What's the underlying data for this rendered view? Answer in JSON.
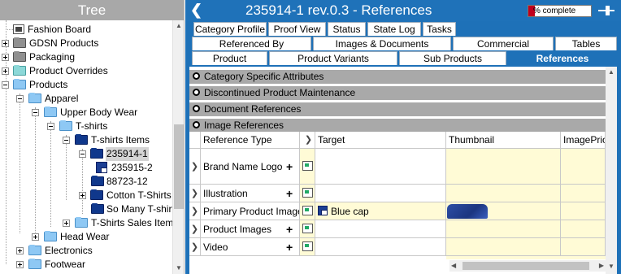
{
  "tree": {
    "title": "Tree",
    "items": [
      {
        "label": "Fashion Board"
      },
      {
        "label": "GDSN Products"
      },
      {
        "label": "Packaging"
      },
      {
        "label": "Product Overrides"
      },
      {
        "label": "Products"
      },
      {
        "label": "Apparel"
      },
      {
        "label": "Upper Body Wear"
      },
      {
        "label": "T-shirts"
      },
      {
        "label": "T-shirts Items"
      },
      {
        "label": "235914-1"
      },
      {
        "label": "235915-2"
      },
      {
        "label": "88723-12"
      },
      {
        "label": "Cotton T-Shirts"
      },
      {
        "label": "So Many T-shirts"
      },
      {
        "label": "T-Shirts Sales Items"
      },
      {
        "label": "Head Wear"
      },
      {
        "label": "Electronics"
      },
      {
        "label": "Footwear"
      }
    ]
  },
  "header": {
    "title": "235914-1 rev.0.3 - References",
    "progress_label": "% complete",
    "progress_fraction": 0.1,
    "back_icon": "back-chevron-icon",
    "pin_icon": "pin-icon"
  },
  "tabs": {
    "row1": [
      "Category Profile",
      "Proof View",
      "Status",
      "State Log",
      "Tasks"
    ],
    "row2": [
      "Referenced By",
      "Images & Documents",
      "Commercial",
      "Tables"
    ],
    "row3": [
      "Product",
      "Product Variants",
      "Sub Products",
      "References"
    ],
    "active": "References"
  },
  "sections": [
    "Category Specific Attributes",
    "Discontinued Product Maintenance",
    "Document References",
    "Image References"
  ],
  "table": {
    "columns": [
      "Reference Type",
      "Target",
      "Thumbnail",
      "ImagePriori"
    ],
    "rows": [
      {
        "type": "Brand Name Logo",
        "target": "",
        "has_thumbnail": false
      },
      {
        "type": "Illustration",
        "target": "",
        "has_thumbnail": false
      },
      {
        "type": "Primary Product Image",
        "target": "Blue cap",
        "has_thumbnail": true
      },
      {
        "type": "Product Images",
        "target": "",
        "has_thumbnail": false
      },
      {
        "type": "Video",
        "target": "",
        "has_thumbnail": false
      }
    ]
  },
  "colors": {
    "accent": "#1e71b8",
    "tree_header": "#a8a8a8",
    "section_bar": "#a9a9a9",
    "cell_highlight": "#fffbd6",
    "progress_fill": "#c0001c"
  }
}
